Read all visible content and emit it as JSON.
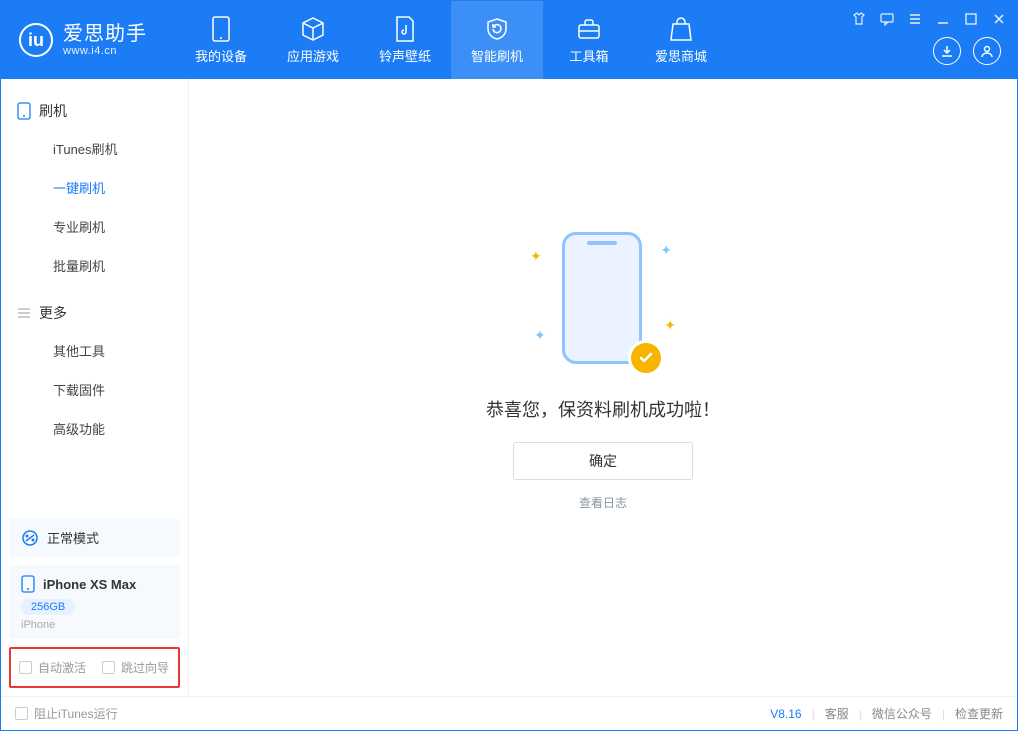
{
  "brand": {
    "name": "爱思助手",
    "url": "www.i4.cn"
  },
  "nav": {
    "items": [
      {
        "label": "我的设备"
      },
      {
        "label": "应用游戏"
      },
      {
        "label": "铃声壁纸"
      },
      {
        "label": "智能刷机"
      },
      {
        "label": "工具箱"
      },
      {
        "label": "爱思商城"
      }
    ],
    "active_index": 3
  },
  "sidebar": {
    "group1_title": "刷机",
    "group1_items": [
      "iTunes刷机",
      "一键刷机",
      "专业刷机",
      "批量刷机"
    ],
    "group1_active_index": 1,
    "group2_title": "更多",
    "group2_items": [
      "其他工具",
      "下载固件",
      "高级功能"
    ],
    "mode_label": "正常模式",
    "device": {
      "name": "iPhone XS Max",
      "storage": "256GB",
      "type": "iPhone"
    },
    "opt1": "自动激活",
    "opt2": "跳过向导"
  },
  "main": {
    "success_text": "恭喜您，保资料刷机成功啦！",
    "ok_label": "确定",
    "log_link": "查看日志"
  },
  "status": {
    "block_itunes": "阻止iTunes运行",
    "version": "V8.16",
    "link1": "客服",
    "link2": "微信公众号",
    "link3": "检查更新"
  }
}
